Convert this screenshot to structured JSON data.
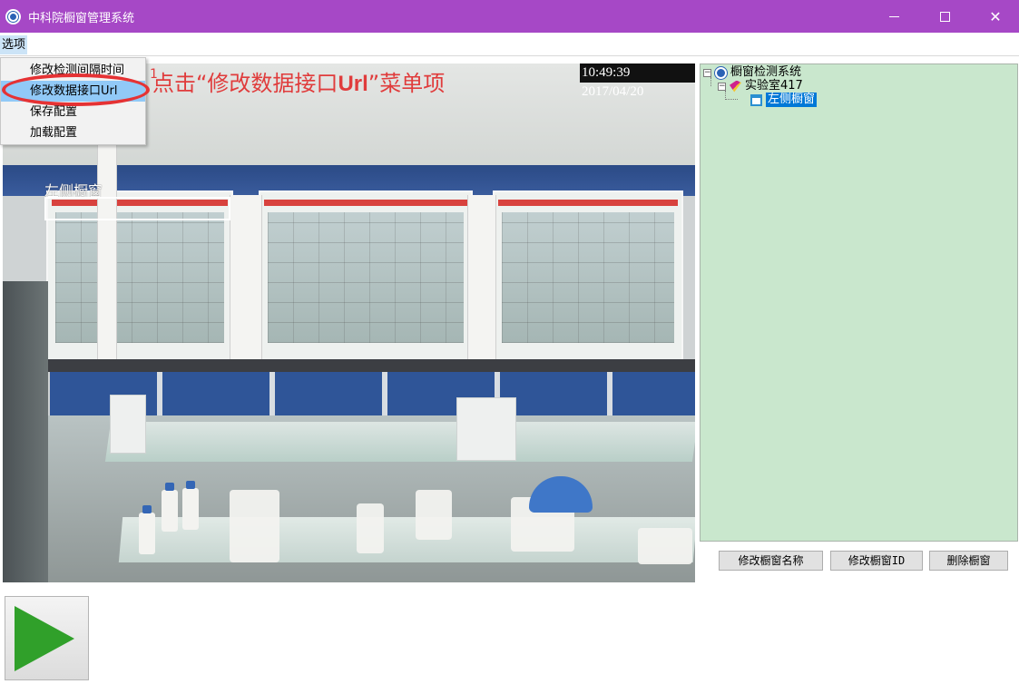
{
  "window": {
    "title": "中科院橱窗管理系统",
    "icon": "app-logo-icon",
    "controls": {
      "minimize": "minimize-icon",
      "maximize": "maximize-icon",
      "close": "close-icon"
    }
  },
  "menubar": {
    "options_label": "选项"
  },
  "dropdown": {
    "items": [
      {
        "label": "修改检测间隔时间"
      },
      {
        "label": "修改数据接口Url",
        "highlighted": true
      },
      {
        "label": "保存配置"
      },
      {
        "label": "加载配置"
      }
    ]
  },
  "video": {
    "timestamp": "10:49:39 2017/04/20",
    "roi_label": "左侧橱窗",
    "annotation_marker": "1",
    "annotation_prefix": "点击“修改数据接口",
    "annotation_bold": "Url",
    "annotation_suffix": "”菜单项",
    "annotation_color": "#e03c3c"
  },
  "tree": {
    "root": "橱窗检测系统",
    "lab": "实验室417",
    "hood": "左侧橱窗"
  },
  "buttons": {
    "rename": "修改橱窗名称",
    "change_id": "修改橱窗ID",
    "delete": "删除橱窗"
  },
  "colors": {
    "titlebar": "#a648c6",
    "tree_bg": "#c9e7cd",
    "selection": "#0078d7",
    "play": "#30a02a"
  }
}
